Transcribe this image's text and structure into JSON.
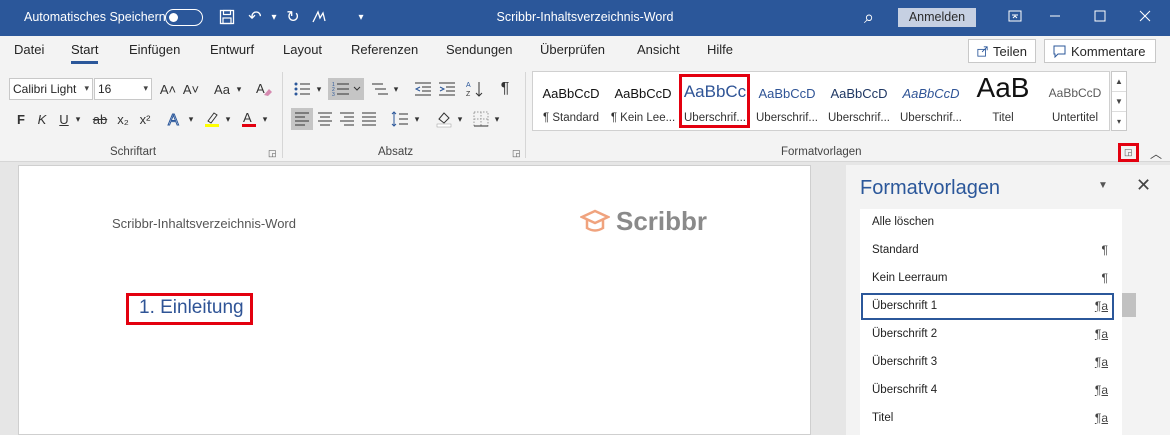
{
  "titlebar": {
    "autosave_label": "Automatisches Speichern",
    "doc_title": "Scribbr-Inhaltsverzeichnis-Word",
    "signin_label": "Anmelden",
    "undo_arrow": "↶",
    "redo": "↻",
    "dropdown_caret": "▾",
    "search_glyph": "⌕"
  },
  "tabs": [
    "Datei",
    "Start",
    "Einfügen",
    "Entwurf",
    "Layout",
    "Referenzen",
    "Sendungen",
    "Überprüfen",
    "Ansicht",
    "Hilfe"
  ],
  "share_label": "Teilen",
  "comments_label": "Kommentare",
  "font": {
    "name": "Calibri Light",
    "size": "16",
    "group_label": "Schriftart",
    "bold": "F",
    "italic": "K",
    "underline": "U",
    "strike": "ab",
    "subscript": "x₂",
    "superscript": "x²",
    "grow": "A˄",
    "shrink": "A˅",
    "case": "Aa"
  },
  "paragraph": {
    "group_label": "Absatz",
    "pilcrow": "¶"
  },
  "styles_group_label": "Formatvorlagen",
  "gallery": [
    {
      "preview": "AaBbCcD",
      "name": "¶ Standard",
      "color": "#111111"
    },
    {
      "preview": "AaBbCcD",
      "name": "¶ Kein Lee...",
      "color": "#111111"
    },
    {
      "preview": "AaBbCс",
      "name": "Überschrif...",
      "color": "#2f5496"
    },
    {
      "preview": "AaBbCcD",
      "name": "Überschrif...",
      "color": "#2f5496"
    },
    {
      "preview": "AaBbCcD",
      "name": "Überschrif...",
      "color": "#1f3763"
    },
    {
      "preview": "AaBbCcD",
      "name": "Überschrif...",
      "color": "#2f5496"
    },
    {
      "preview": "AaB",
      "name": "Titel",
      "color": "#111111"
    },
    {
      "preview": "AaBbCcD",
      "name": "Untertitel",
      "color": "#5a5a5a"
    }
  ],
  "document": {
    "header": "Scribbr-Inhaltsverzeichnis-Word",
    "logo_text": "Scribbr",
    "heading": "1.  Einleitung"
  },
  "pane": {
    "title": "Formatvorlagen",
    "items": [
      {
        "name": "Alle löschen",
        "mark": ""
      },
      {
        "name": "Standard",
        "mark": "¶"
      },
      {
        "name": "Kein Leerraum",
        "mark": "¶"
      },
      {
        "name": "Überschrift 1",
        "mark": "¶a"
      },
      {
        "name": "Überschrift 2",
        "mark": "¶a"
      },
      {
        "name": "Überschrift 3",
        "mark": "¶a"
      },
      {
        "name": "Überschrift 4",
        "mark": "¶a"
      },
      {
        "name": "Titel",
        "mark": "¶a"
      }
    ]
  },
  "colors": {
    "accent": "#2b579a",
    "highlight_red": "#e3000f",
    "heading_blue": "#2f5496"
  }
}
